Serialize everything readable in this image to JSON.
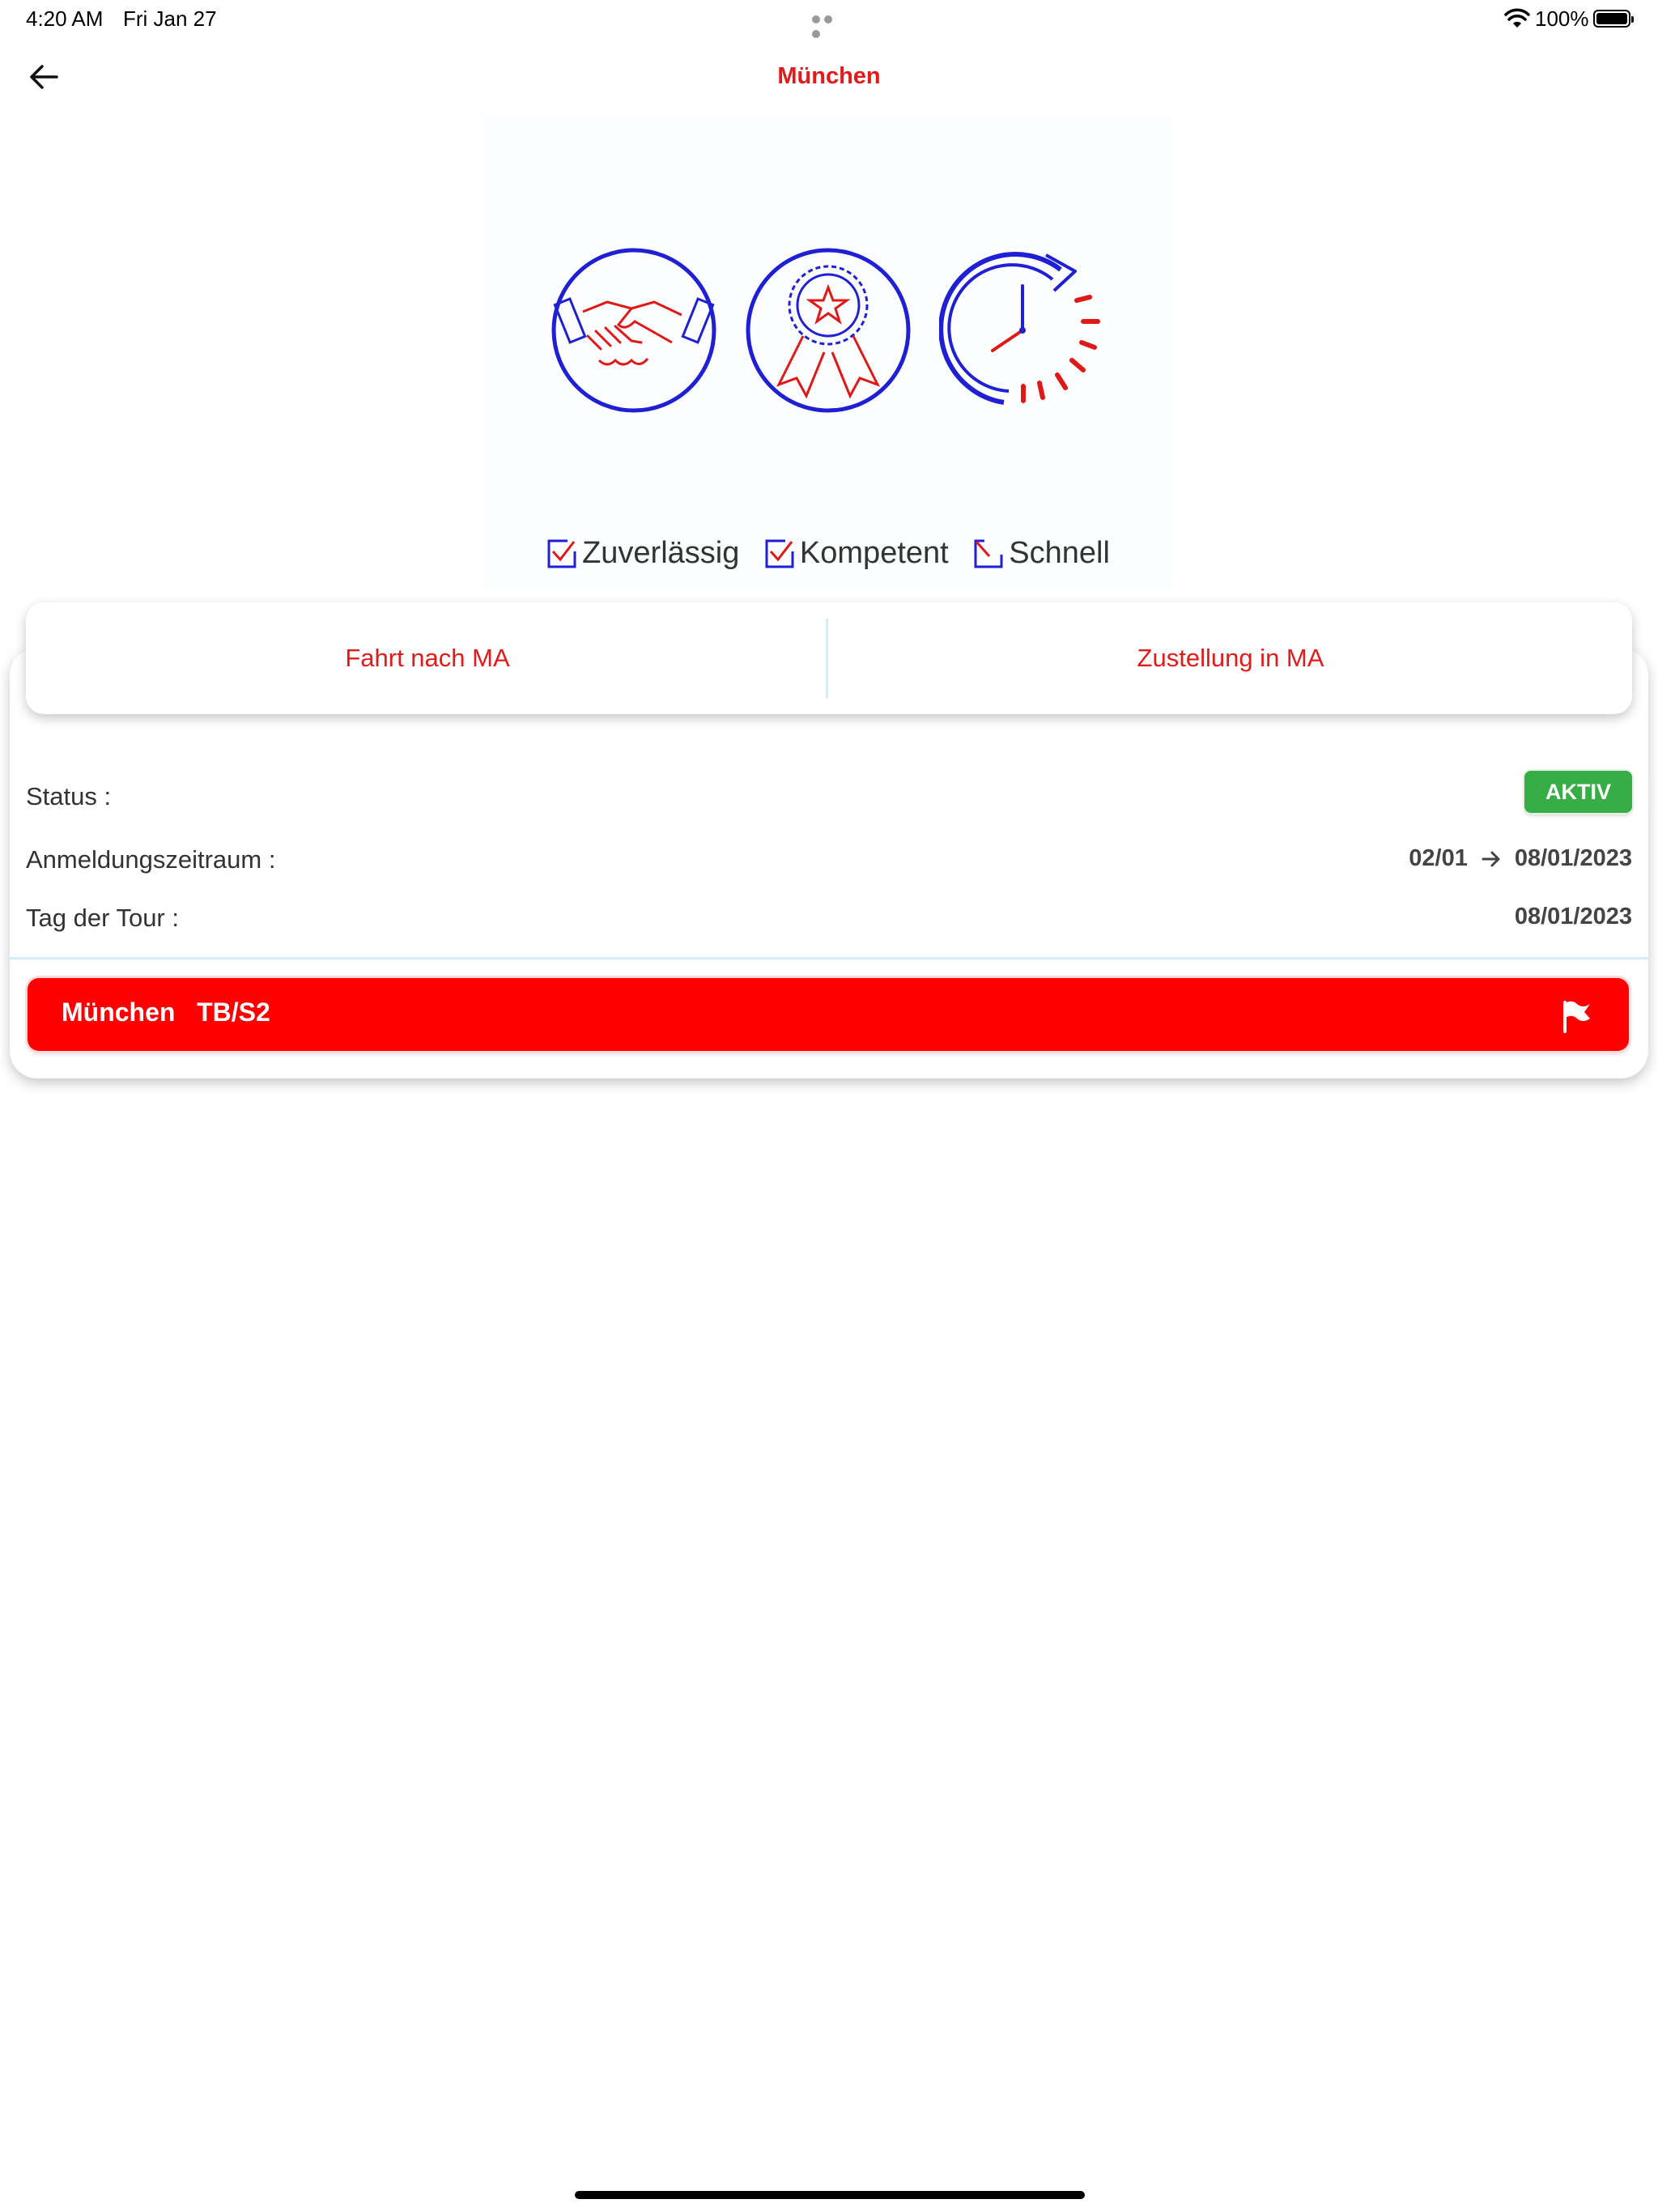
{
  "status_bar": {
    "time": "4:20 AM",
    "date": "Fri Jan 27",
    "battery": "100%"
  },
  "nav": {
    "title": "München",
    "back_icon": "arrow-left-icon"
  },
  "hero": {
    "icons": [
      "handshake-icon",
      "award-rosette-icon",
      "clock-refresh-icon"
    ],
    "labels": [
      "Zuverlässig",
      "Kompetent",
      "Schnell"
    ]
  },
  "tabs": [
    {
      "label": "Fahrt nach MA"
    },
    {
      "label": "Zustellung in MA"
    }
  ],
  "details": {
    "status_label": "Status :",
    "status_value": "AKTIV",
    "period_label": "Anmeldungszeitraum :",
    "period_from": "02/01",
    "period_to": "08/01/2023",
    "tour_day_label": "Tag der Tour :",
    "tour_day_value": "08/01/2023"
  },
  "tour_button": {
    "label": "München   TB/S2",
    "icon": "flag-icon"
  },
  "colors": {
    "accent_red": "#ff0000",
    "title_red": "#e41a1a",
    "status_green": "#36ad45",
    "icon_blue": "#1f1fd6"
  }
}
